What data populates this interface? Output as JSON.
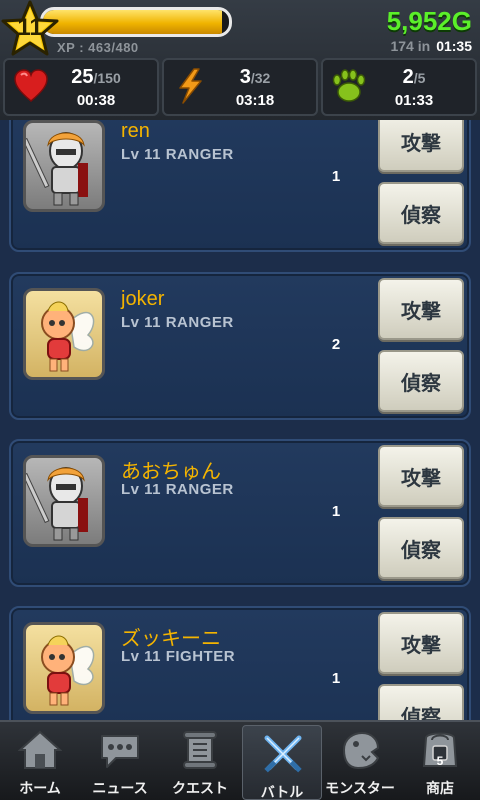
{
  "header": {
    "level": "11",
    "xp_text": "XP : 463/480",
    "xp_progress": 0.965,
    "gold": "5,952G",
    "gold_in_label": "174 in",
    "gold_timer": "01:35",
    "stats": [
      {
        "icon": "heart-icon",
        "value": "25",
        "max": "/150",
        "timer": "00:38"
      },
      {
        "icon": "lightning-icon",
        "value": "3",
        "max": "/32",
        "timer": "03:18"
      },
      {
        "icon": "paw-icon",
        "value": "2",
        "max": "/5",
        "timer": "01:33"
      }
    ]
  },
  "players": [
    {
      "name": "ren",
      "info": "Lv 11  RANGER",
      "rank": "1",
      "avatar": "armored-knight-avatar",
      "attack_label": "攻撃",
      "scout_label": "偵察"
    },
    {
      "name": "joker",
      "info": "Lv 11  RANGER",
      "rank": "2",
      "avatar": "fairy-baby-avatar",
      "attack_label": "攻撃",
      "scout_label": "偵察"
    },
    {
      "name": "あおちゅん",
      "info": "Lv 11  RANGER",
      "rank": "1",
      "avatar": "armored-knight-avatar",
      "attack_label": "攻撃",
      "scout_label": "偵察"
    },
    {
      "name": "ズッキーニ",
      "info": "Lv 11  FIGHTER",
      "rank": "1",
      "avatar": "fairy-baby-avatar",
      "attack_label": "攻撃",
      "scout_label": "偵察"
    }
  ],
  "nav": [
    {
      "label": "ホーム",
      "icon": "home-icon",
      "active": false
    },
    {
      "label": "ニュース",
      "icon": "speech-bubble-icon",
      "active": false
    },
    {
      "label": "クエスト",
      "icon": "scroll-icon",
      "active": false
    },
    {
      "label": "バトル",
      "icon": "crossed-swords-icon",
      "active": true
    },
    {
      "label": "モンスター",
      "icon": "monster-icon",
      "active": false
    },
    {
      "label": "商店",
      "icon": "shop-icon",
      "active": false,
      "badge": "5"
    }
  ],
  "colors": {
    "gold": "#5bef2a",
    "player_name": "#f4b400",
    "xp_fill": "#f0b400"
  }
}
